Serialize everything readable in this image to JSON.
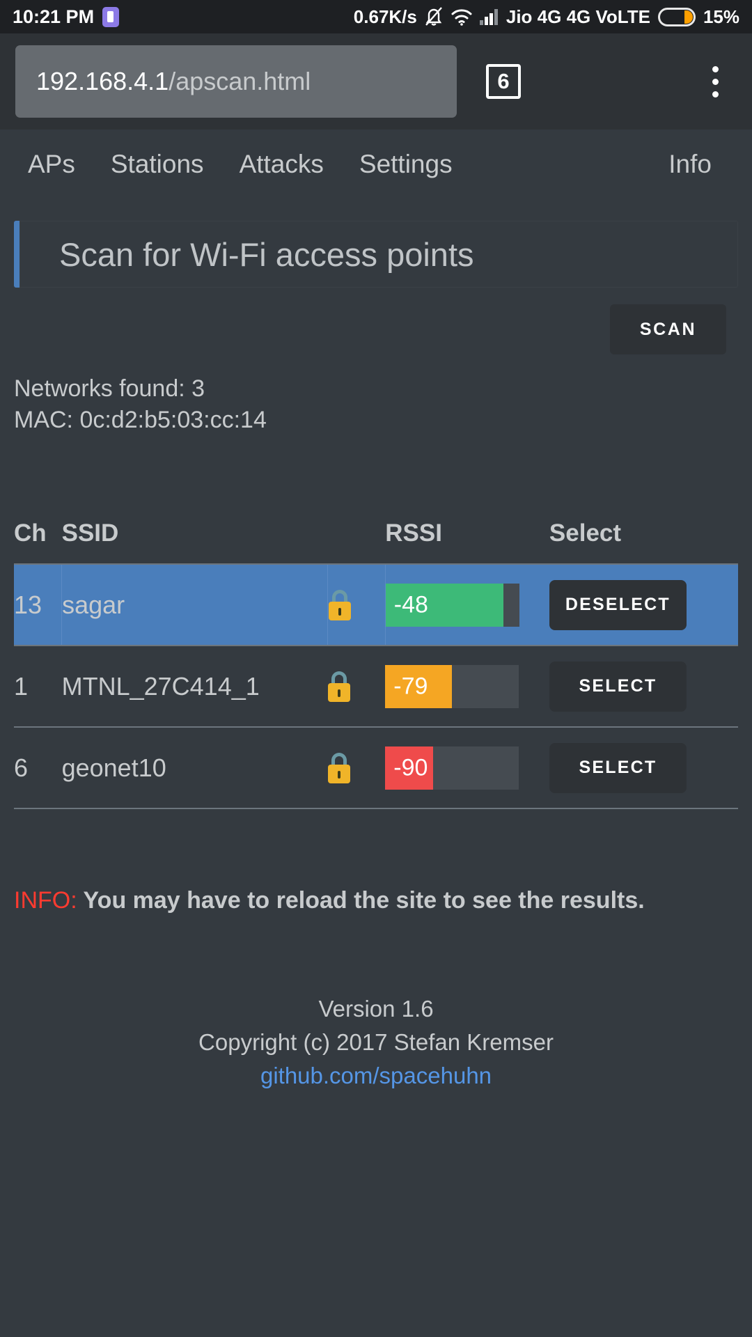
{
  "statusbar": {
    "time": "10:21 PM",
    "network_speed": "0.67K/s",
    "carrier": "Jio 4G 4G VoLTE",
    "battery_percent": "15%",
    "icons": [
      "app-notification-icon",
      "mute-bell-icon",
      "wifi-icon",
      "signal-bars-icon",
      "battery-icon"
    ]
  },
  "browser": {
    "url_host": "192.168.4.1",
    "url_path": "/apscan.html",
    "tab_count": "6",
    "menu_icon": "kebab-menu-icon"
  },
  "nav": {
    "items": [
      {
        "label": "APs"
      },
      {
        "label": "Stations"
      },
      {
        "label": "Attacks"
      },
      {
        "label": "Settings"
      }
    ],
    "right": {
      "label": "Info"
    }
  },
  "page": {
    "title": "Scan for Wi-Fi access points",
    "scan_button": "SCAN",
    "networks_found": "Networks found: 3",
    "mac": "MAC: 0c:d2:b5:03:cc:14"
  },
  "table": {
    "headers": {
      "ch": "Ch",
      "ssid": "SSID",
      "lock": "",
      "rssi": "RSSI",
      "select": "Select"
    },
    "rows": [
      {
        "ch": "13",
        "ssid": "sagar",
        "encrypted": true,
        "rssi": "-48",
        "rssi_percent": 88,
        "rssi_color": "#3dba78",
        "button": "DESELECT",
        "selected": true
      },
      {
        "ch": "1",
        "ssid": "MTNL_27C414_1",
        "encrypted": true,
        "rssi": "-79",
        "rssi_percent": 50,
        "rssi_color": "#f5a623",
        "button": "SELECT",
        "selected": false
      },
      {
        "ch": "6",
        "ssid": "geonet10",
        "encrypted": true,
        "rssi": "-90",
        "rssi_percent": 36,
        "rssi_color": "#ef4b4b",
        "button": "SELECT",
        "selected": false
      }
    ]
  },
  "info": {
    "tag": "INFO:",
    "message": "You may have to reload the site to see the results."
  },
  "footer": {
    "version": "Version 1.6",
    "copyright": "Copyright (c) 2017 Stefan Kremser",
    "link": "github.com/spacehuhn"
  },
  "colors": {
    "background": "#343a40",
    "panel": "#2e3236",
    "accent_blue": "#4a7ebb",
    "link_blue": "#5596e6",
    "text": "#c8cbcd",
    "info_red": "#ff3b30"
  }
}
